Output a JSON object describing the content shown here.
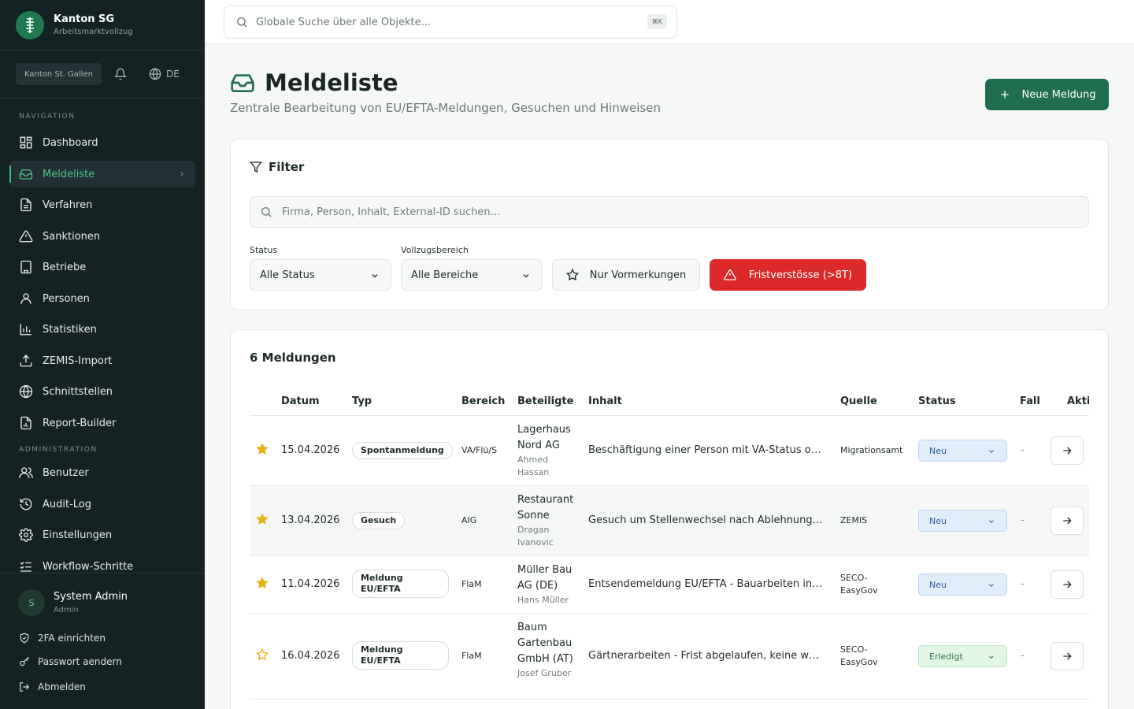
{
  "brand": {
    "title": "Kanton SG",
    "subtitle": "Arbeitsmarktvollzug"
  },
  "toolbar": {
    "canton": "Kanton St. Gallen",
    "language": "DE"
  },
  "nav": {
    "section_label": "NAVIGATION",
    "items": [
      {
        "label": "Dashboard",
        "icon": "dashboard-icon"
      },
      {
        "label": "Meldeliste",
        "icon": "inbox-icon",
        "active": true
      },
      {
        "label": "Verfahren",
        "icon": "document-icon"
      },
      {
        "label": "Sanktionen",
        "icon": "warning-icon"
      },
      {
        "label": "Betriebe",
        "icon": "building-icon"
      },
      {
        "label": "Personen",
        "icon": "person-icon"
      },
      {
        "label": "Statistiken",
        "icon": "chart-icon"
      },
      {
        "label": "ZEMIS-Import",
        "icon": "upload-icon"
      },
      {
        "label": "Schnittstellen",
        "icon": "globe-icon"
      },
      {
        "label": "Report-Builder",
        "icon": "report-icon"
      }
    ]
  },
  "admin": {
    "section_label": "ADMINISTRATION",
    "items": [
      {
        "label": "Benutzer",
        "icon": "users-icon"
      },
      {
        "label": "Audit-Log",
        "icon": "history-icon"
      },
      {
        "label": "Einstellungen",
        "icon": "gear-icon"
      },
      {
        "label": "Workflow-Schritte",
        "icon": "list-check-icon"
      }
    ]
  },
  "user": {
    "initial": "S",
    "name": "System Admin",
    "role": "Admin"
  },
  "footer_links": {
    "twofa": "2FA einrichten",
    "password": "Passwort aendern",
    "logout": "Abmelden"
  },
  "global_search": {
    "placeholder": "Globale Suche über alle Objekte...",
    "shortcut": "⌘K"
  },
  "page": {
    "title": "Meldeliste",
    "subtitle": "Zentrale Bearbeitung von EU/EFTA-Meldungen, Gesuchen und Hinweisen",
    "new_button": "Neue Meldung"
  },
  "filter": {
    "title": "Filter",
    "search_placeholder": "Firma, Person, Inhalt, External-ID suchen...",
    "status_label": "Status",
    "status_value": "Alle Status",
    "bereich_label": "Vollzugsbereich",
    "bereich_value": "Alle Bereiche",
    "vormerkungen_button": "Nur Vormerkungen",
    "frist_button": "Fristverstösse (>8T)"
  },
  "table": {
    "count_title": "6 Meldungen",
    "headers": {
      "datum": "Datum",
      "typ": "Typ",
      "bereich": "Bereich",
      "beteiligte": "Beteiligte",
      "inhalt": "Inhalt",
      "quelle": "Quelle",
      "status": "Status",
      "fall": "Fall",
      "aktion": "Akti"
    },
    "rows": [
      {
        "starred": true,
        "datum": "15.04.2026",
        "typ": "Spontanmeldung",
        "bereich": "VA/Flü/S",
        "firma": "Lagerhaus Nord AG",
        "person": "Ahmed Hassan",
        "inhalt": "Beschäftigung einer Person mit VA-Status ohne Bewilligung",
        "quelle": "Migrationsamt",
        "status": "Neu",
        "fall": "-"
      },
      {
        "starred": true,
        "datum": "13.04.2026",
        "typ": "Gesuch",
        "bereich": "AIG",
        "firma": "Restaurant Sonne",
        "person": "Dragan Ivanovic",
        "inhalt": "Gesuch um Stellenwechsel nach Ablehnung der Bewilligung",
        "quelle": "ZEMIS",
        "status": "Neu",
        "fall": "-"
      },
      {
        "starred": true,
        "datum": "11.04.2026",
        "typ": "Meldung EU/EFTA",
        "bereich": "FlaM",
        "firma": "Müller Bau AG (DE)",
        "person": "Hans Müller",
        "inhalt": "Entsendemeldung EU/EFTA - Bauarbeiten in St. Gallen",
        "quelle": "SECO-EasyGov",
        "status": "Neu",
        "fall": "-"
      },
      {
        "starred": false,
        "datum": "16.04.2026",
        "typ": "Meldung EU/EFTA",
        "bereich": "FlaM",
        "firma": "Baum Gartenbau GmbH (AT)",
        "person": "Josef Gruber",
        "inhalt": "Gärtnerarbeiten - Frist abgelaufen, keine weiteren Schritte",
        "quelle": "SECO-EasyGov",
        "status": "Erledigt",
        "fall": "-"
      }
    ]
  },
  "colors": {
    "sidebar_bg": "#152224",
    "accent": "#1f6e4d",
    "danger": "#dc2a2a",
    "star": "#e8b21a"
  }
}
